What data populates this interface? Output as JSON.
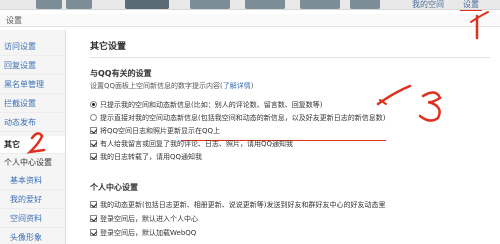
{
  "topbar": {
    "right_home": "我的空间",
    "right_settings": "设置"
  },
  "breadcrumb": "设置",
  "sidebar": {
    "items": [
      {
        "label": "访问设置"
      },
      {
        "label": "回复设置"
      },
      {
        "label": "黑名单管理"
      },
      {
        "label": "拦截设置"
      },
      {
        "label": "动态发布"
      },
      {
        "label": "其它"
      }
    ],
    "group_label": "个人中心设置",
    "sub_items": [
      {
        "label": "基本资料"
      },
      {
        "label": "我的爱好"
      },
      {
        "label": "空间资料"
      },
      {
        "label": "头像形象"
      }
    ]
  },
  "main": {
    "title": "其它设置",
    "qq_section": {
      "title": "与QQ有关的设置",
      "desc": "设置QQ面板上空间新信息的数字提示内容(",
      "desc_link": "了解详情",
      "desc_end": ")",
      "options": [
        {
          "type": "radio",
          "checked": true,
          "label": "只提示我的空间和动态新信息(比如：别人的评论数、留言数、回复数等)"
        },
        {
          "type": "radio",
          "checked": false,
          "label": "提示直接对我的空间动态新信息(包括我空间和动态的新信息，以及好友更新日志的新信息数)"
        },
        {
          "type": "checkbox",
          "checked": true,
          "label": "将QQ空间日志和照片更新显示在QQ上"
        },
        {
          "type": "checkbox",
          "checked": true,
          "label": "有人给我留言或回复了我的评论、日志、照片，请用QQ通知我"
        },
        {
          "type": "checkbox",
          "checked": true,
          "label": "我的日志转载了，请用QQ通知我"
        }
      ]
    },
    "center_section": {
      "title": "个人中心设置",
      "options": [
        {
          "type": "checkbox",
          "checked": true,
          "label": "我的动态更新(包括日志更新、相册更新、说说更新等)发送到好友和群好友中心的好友动态里"
        },
        {
          "type": "checkbox",
          "checked": true,
          "label": "登录空间后，默认进入个人中心"
        },
        {
          "type": "checkbox",
          "checked": true,
          "label": "登录空间后，默认加载WebQQ"
        }
      ]
    }
  },
  "annotations": {
    "one": "1",
    "two": "2",
    "three": "3",
    "color": "#e0301e"
  }
}
